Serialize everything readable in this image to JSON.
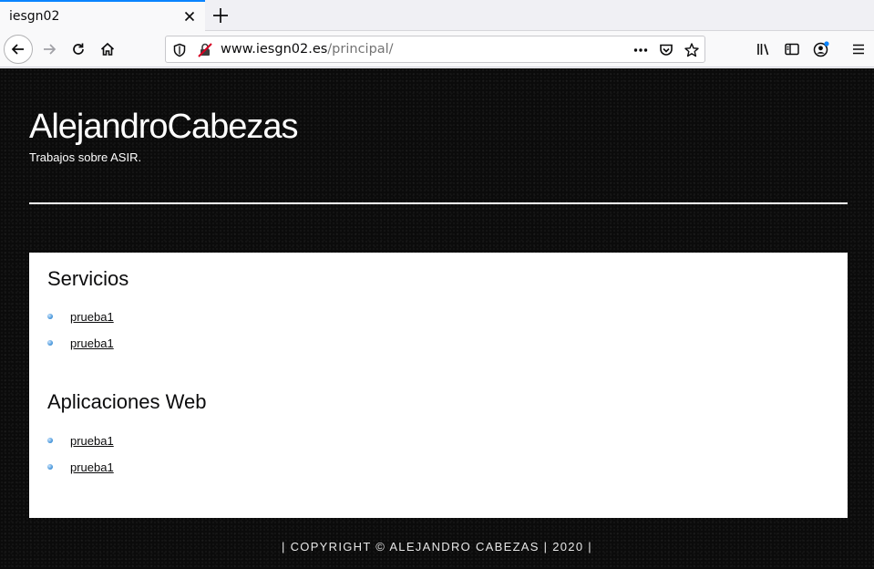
{
  "browser": {
    "tab": {
      "title": "iesgn02"
    },
    "url": {
      "host": "www.iesgn02.es",
      "path": "/principal/"
    }
  },
  "icons": {
    "tab_close": "close-icon",
    "new_tab": "plus-icon",
    "back": "arrow-left-icon",
    "forward": "arrow-right-icon",
    "reload": "reload-icon",
    "home": "home-icon",
    "tracking": "shield-icon",
    "insecure": "insecure-lock-icon",
    "page_actions": "ellipsis-icon",
    "pocket": "pocket-icon",
    "bookmark": "star-icon",
    "library": "library-icon",
    "sidebar": "sidebar-icon",
    "account": "account-icon",
    "menu": "hamburger-menu-icon"
  },
  "site": {
    "title": "AlejandroCabezas",
    "tagline": "Trabajos sobre ASIR.",
    "sections": [
      {
        "title": "Servicios",
        "links": [
          "prueba1",
          "prueba1"
        ]
      },
      {
        "title": "Aplicaciones Web",
        "links": [
          "prueba1",
          "prueba1"
        ]
      }
    ],
    "footer": "| COPYRIGHT © ALEJANDRO CABEZAS | 2020 |"
  },
  "colors": {
    "accent": "#0a84ff",
    "page_background": "#0b0b0b",
    "content_background": "#ffffff"
  }
}
